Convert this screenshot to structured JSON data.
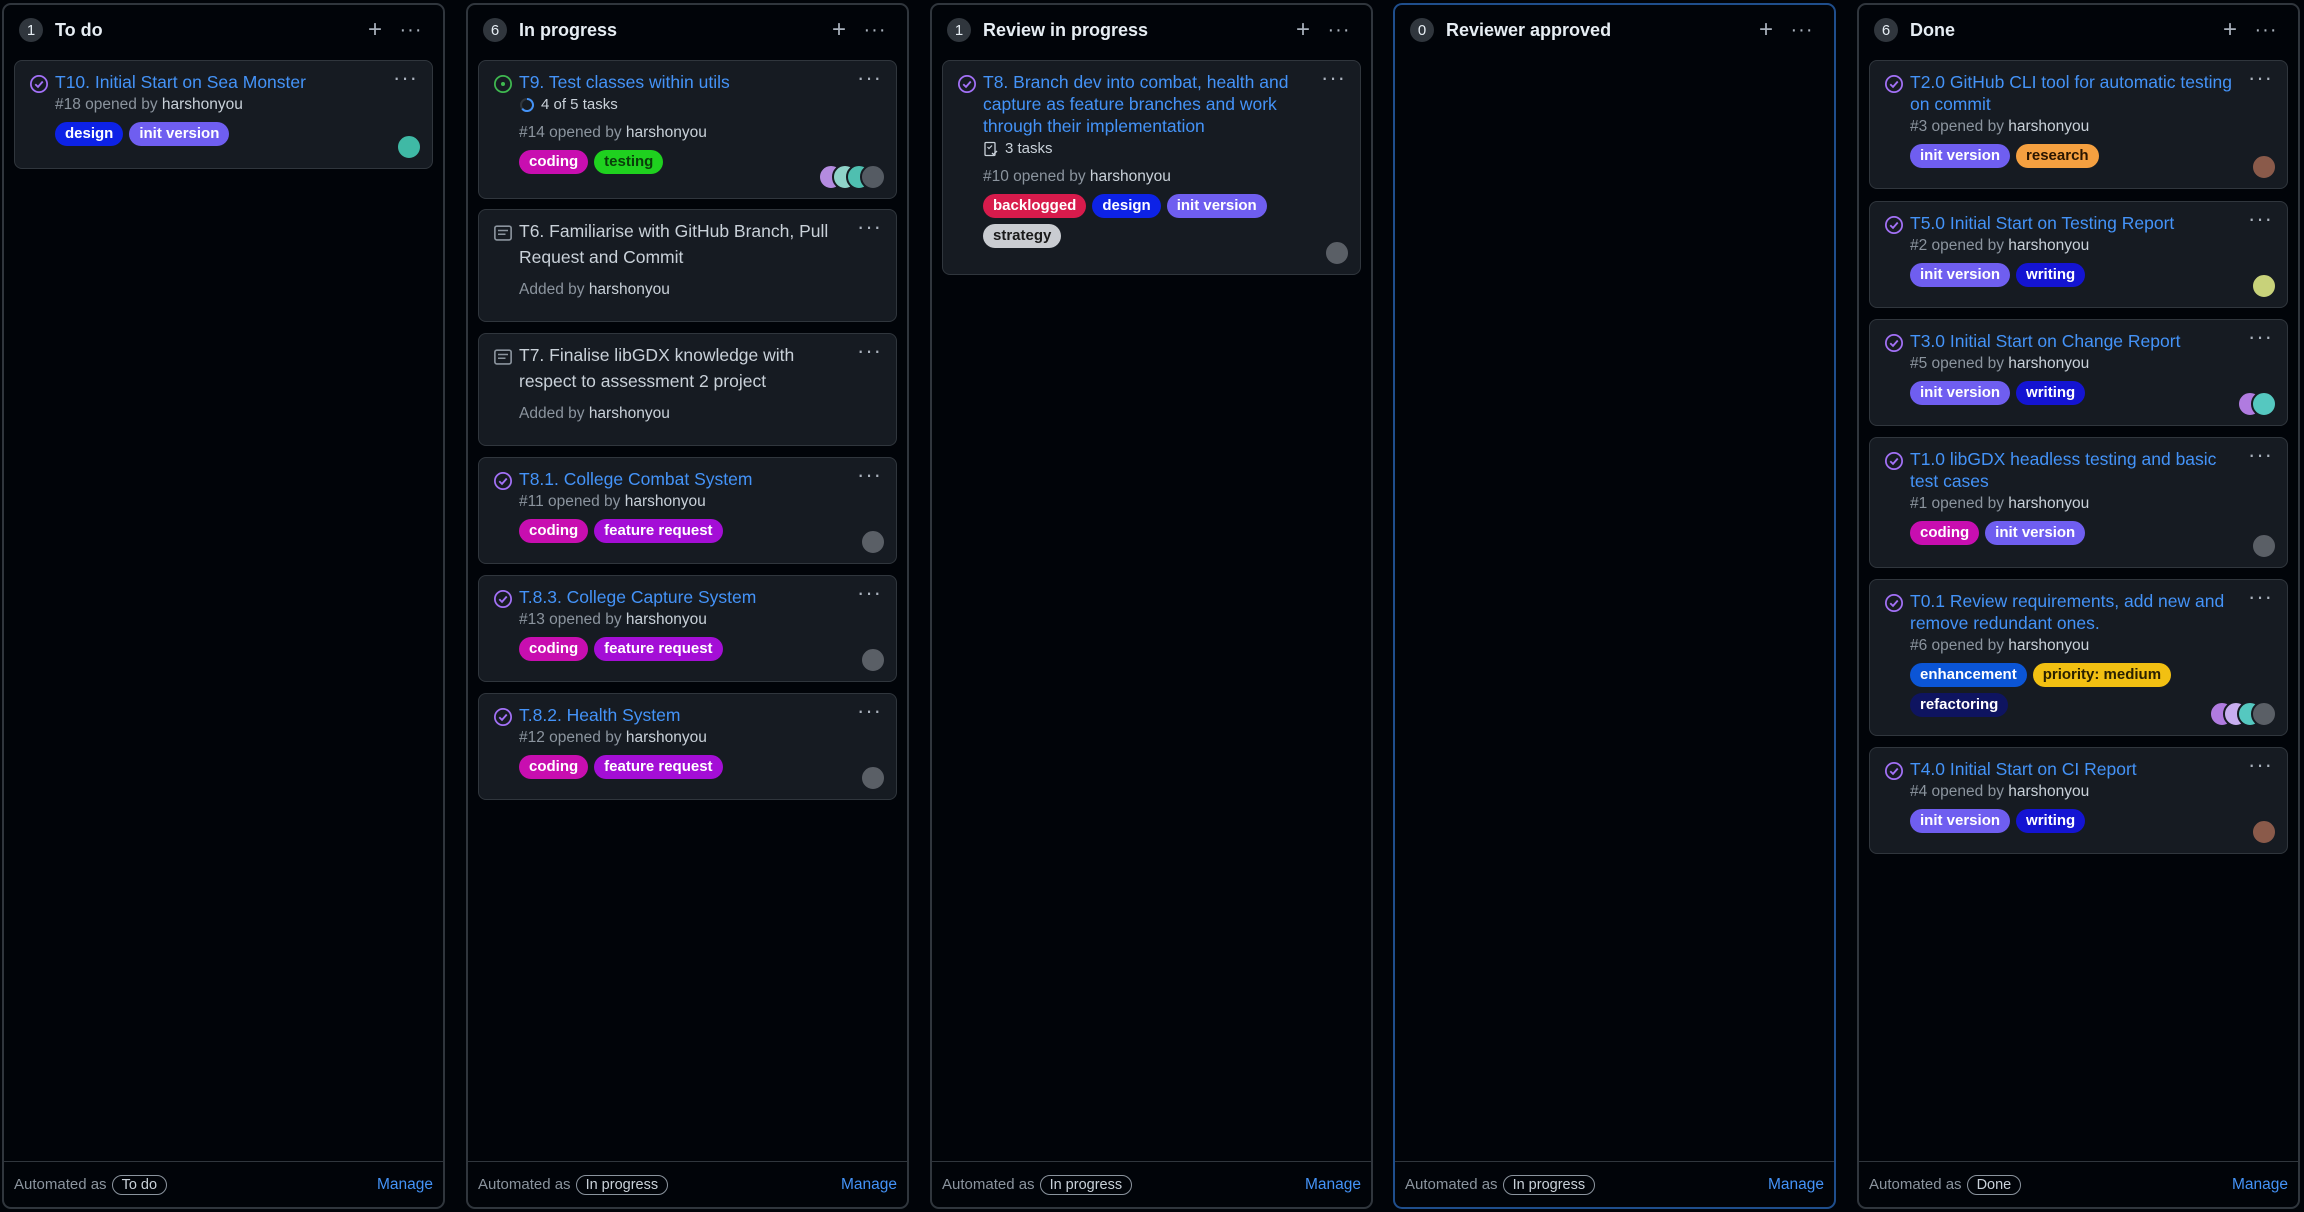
{
  "colors": {
    "card_bg": "#161b22",
    "border": "#30363d",
    "link": "#4493f8",
    "issue_closed": "#a371f7",
    "issue_open": "#3fb950"
  },
  "columns": [
    {
      "count": "1",
      "title": "To do",
      "highlight": false,
      "footer": {
        "prefix": "Automated as",
        "pill": "To do",
        "manage": "Manage"
      },
      "cards": [
        {
          "title": "T10. Initial Start on Sea Monster",
          "number": "#18 opened by",
          "author": "harshonyou",
          "icon": "issue-closed-icon",
          "labels": [
            {
              "text": "design",
              "bg": "#0d22e6",
              "fg": "#ffffff"
            },
            {
              "text": "init version",
              "bg": "#6f5ef0",
              "fg": "#ffffff"
            }
          ]
        }
      ]
    },
    {
      "count": "6",
      "title": "In progress",
      "highlight": false,
      "footer": {
        "prefix": "Automated as",
        "pill": "In progress",
        "manage": "Manage"
      },
      "cards": [
        {
          "title": "T9. Test classes within utils",
          "number": "#14 opened by",
          "author": "harshonyou",
          "icon": "issue-open-icon",
          "tasks": "4 of 5 tasks",
          "labels": [
            {
              "text": "coding",
              "bg": "#c80eb0",
              "fg": "#ffffff"
            },
            {
              "text": "testing",
              "bg": "#1fd11f",
              "fg": "#0a3d0a"
            }
          ]
        },
        {
          "title": "T6. Familiarise with GitHub Branch, Pull Request and Commit",
          "added": "Added by",
          "author": "harshonyou",
          "icon": "draft-issue-icon"
        },
        {
          "title": "T7. Finalise libGDX knowledge with respect to assessment 2 project",
          "added": "Added by",
          "author": "harshonyou",
          "icon": "draft-issue-icon"
        },
        {
          "title": "T8.1. College Combat System",
          "number": "#11 opened by",
          "author": "harshonyou",
          "icon": "issue-closed-icon",
          "labels": [
            {
              "text": "coding",
              "bg": "#c80eb0",
              "fg": "#ffffff"
            },
            {
              "text": "feature request",
              "bg": "#a40ed6",
              "fg": "#ffffff"
            }
          ]
        },
        {
          "title": "T.8.3. College Capture System",
          "number": "#13 opened by",
          "author": "harshonyou",
          "icon": "issue-closed-icon",
          "labels": [
            {
              "text": "coding",
              "bg": "#c80eb0",
              "fg": "#ffffff"
            },
            {
              "text": "feature request",
              "bg": "#a40ed6",
              "fg": "#ffffff"
            }
          ]
        },
        {
          "title": "T.8.2. Health System",
          "number": "#12 opened by",
          "author": "harshonyou",
          "icon": "issue-closed-icon",
          "labels": [
            {
              "text": "coding",
              "bg": "#c80eb0",
              "fg": "#ffffff"
            },
            {
              "text": "feature request",
              "bg": "#a40ed6",
              "fg": "#ffffff"
            }
          ]
        }
      ]
    },
    {
      "count": "1",
      "title": "Review in progress",
      "highlight": false,
      "footer": {
        "prefix": "Automated as",
        "pill": "In progress",
        "manage": "Manage"
      },
      "cards": [
        {
          "title": "T8. Branch dev into combat, health and capture as feature branches and work through their implementation",
          "number": "#10 opened by",
          "author": "harshonyou",
          "icon": "issue-closed-icon",
          "tasks": "3 tasks",
          "labels": [
            {
              "text": "backlogged",
              "bg": "#d81b4c",
              "fg": "#ffffff"
            },
            {
              "text": "design",
              "bg": "#0d22e6",
              "fg": "#ffffff"
            },
            {
              "text": "init version",
              "bg": "#6f5ef0",
              "fg": "#ffffff"
            },
            {
              "text": "strategy",
              "bg": "#c9ccd1",
              "fg": "#1a1a1a"
            }
          ]
        }
      ]
    },
    {
      "count": "0",
      "title": "Reviewer approved",
      "highlight": true,
      "footer": {
        "prefix": "Automated as",
        "pill": "In progress",
        "manage": "Manage"
      },
      "cards": []
    },
    {
      "count": "6",
      "title": "Done",
      "highlight": false,
      "footer": {
        "prefix": "Automated as",
        "pill": "Done",
        "manage": "Manage"
      },
      "cards": [
        {
          "title": "T2.0 GitHub CLI tool for automatic testing on commit",
          "number": "#3 opened by",
          "author": "harshonyou",
          "icon": "issue-closed-icon",
          "labels": [
            {
              "text": "init version",
              "bg": "#6f5ef0",
              "fg": "#ffffff"
            },
            {
              "text": "research",
              "bg": "#f5a040",
              "fg": "#2a1500"
            }
          ]
        },
        {
          "title": "T5.0 Initial Start on Testing Report",
          "number": "#2 opened by",
          "author": "harshonyou",
          "icon": "issue-closed-icon",
          "labels": [
            {
              "text": "init version",
              "bg": "#6f5ef0",
              "fg": "#ffffff"
            },
            {
              "text": "writing",
              "bg": "#1414d2",
              "fg": "#ffffff"
            }
          ]
        },
        {
          "title": "T3.0 Initial Start on Change Report",
          "number": "#5 opened by",
          "author": "harshonyou",
          "icon": "issue-closed-icon",
          "labels": [
            {
              "text": "init version",
              "bg": "#6f5ef0",
              "fg": "#ffffff"
            },
            {
              "text": "writing",
              "bg": "#1414d2",
              "fg": "#ffffff"
            }
          ]
        },
        {
          "title": "T1.0 libGDX headless testing and basic test cases",
          "number": "#1 opened by",
          "author": "harshonyou",
          "icon": "issue-closed-icon",
          "labels": [
            {
              "text": "coding",
              "bg": "#c80eb0",
              "fg": "#ffffff"
            },
            {
              "text": "init version",
              "bg": "#6f5ef0",
              "fg": "#ffffff"
            }
          ]
        },
        {
          "title": "T0.1 Review requirements, add new and remove redundant ones.",
          "number": "#6 opened by",
          "author": "harshonyou",
          "icon": "issue-closed-icon",
          "labels": [
            {
              "text": "enhancement",
              "bg": "#0b55d6",
              "fg": "#ffffff"
            },
            {
              "text": "priority: medium",
              "bg": "#f2c012",
              "fg": "#2a2000"
            },
            {
              "text": "refactoring",
              "bg": "#0e1460",
              "fg": "#ffffff"
            }
          ]
        },
        {
          "title": "T4.0 Initial Start on CI Report",
          "number": "#4 opened by",
          "author": "harshonyou",
          "icon": "issue-closed-icon",
          "labels": [
            {
              "text": "init version",
              "bg": "#6f5ef0",
              "fg": "#ffffff"
            },
            {
              "text": "writing",
              "bg": "#1414d2",
              "fg": "#ffffff"
            }
          ]
        }
      ]
    }
  ]
}
